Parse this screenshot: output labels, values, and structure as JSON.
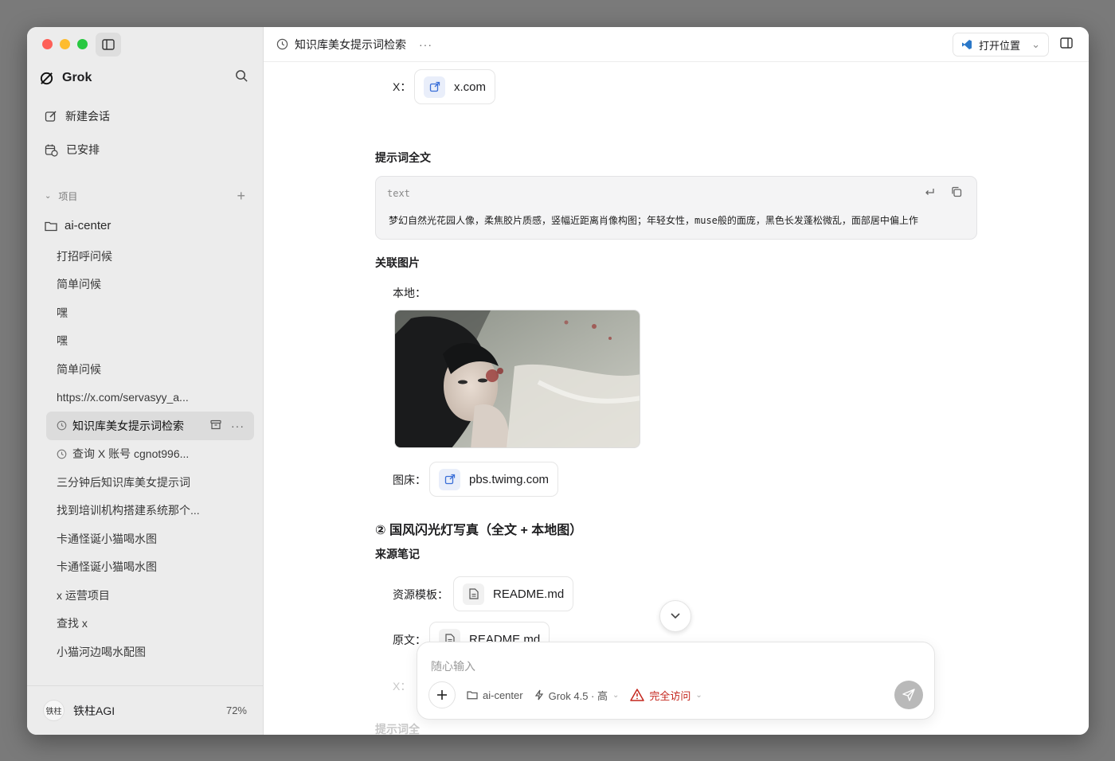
{
  "app": {
    "name": "Grok"
  },
  "sidebar": {
    "new_chat": "新建会话",
    "scheduled": "已安排",
    "section_label": "项目",
    "project_name": "ai-center",
    "conversations": [
      {
        "label": "打招呼问候",
        "icon": ""
      },
      {
        "label": "简单问候",
        "icon": ""
      },
      {
        "label": "嘿",
        "icon": ""
      },
      {
        "label": "嘿",
        "icon": ""
      },
      {
        "label": "简单问候",
        "icon": ""
      },
      {
        "label": "https://x.com/servasyy_a...",
        "icon": ""
      },
      {
        "label": "知识库美女提示词检索",
        "icon": "clock-icon",
        "active": true
      },
      {
        "label": "查询 X 账号 cgnot996...",
        "icon": "clock-icon"
      },
      {
        "label": "三分钟后知识库美女提示词",
        "icon": ""
      },
      {
        "label": "找到培训机构搭建系统那个...",
        "icon": ""
      },
      {
        "label": "卡通怪诞小猫喝水图",
        "icon": ""
      },
      {
        "label": "卡通怪诞小猫喝水图",
        "icon": ""
      },
      {
        "label": "x 运营项目",
        "icon": ""
      },
      {
        "label": "查找 x",
        "icon": ""
      },
      {
        "label": "小猫河边喝水配图",
        "icon": ""
      }
    ],
    "user": {
      "avatar_text": "铁柱",
      "name": "铁柱AGI",
      "usage": "72%"
    }
  },
  "topbar": {
    "title": "知识库美女提示词检索",
    "more": "···",
    "open_location": "打开位置"
  },
  "content": {
    "x_label": "X：",
    "x_link": "x.com",
    "prompt_heading": "提示词全文",
    "code_lang": "text",
    "code_text": "梦幻自然光花园人像，柔焦胶片质感，竖幅近距离肖像构图；年轻女性，muse般的面庞，黑色长发蓬松微乱，面部居中偏上作",
    "images_heading": "关联图片",
    "local_label": "本地：",
    "hosting_label": "图床：",
    "hosting_link": "pbs.twimg.com",
    "section2_heading": "② 国风闪光灯写真（全文 + 本地图）",
    "source_heading": "来源笔记",
    "template_label": "资源模板：",
    "template_file": "README.md",
    "original_label": "原文：",
    "original_file": "README.md",
    "faded_x": "X：",
    "faded_prompt": "提示词全"
  },
  "composer": {
    "placeholder": "随心输入",
    "project": "ai-center",
    "model": "Grok 4.5 · 高",
    "access": "完全访问"
  },
  "colors": {
    "accent_link": "#3b6fd8",
    "warning": "#c4261d"
  }
}
